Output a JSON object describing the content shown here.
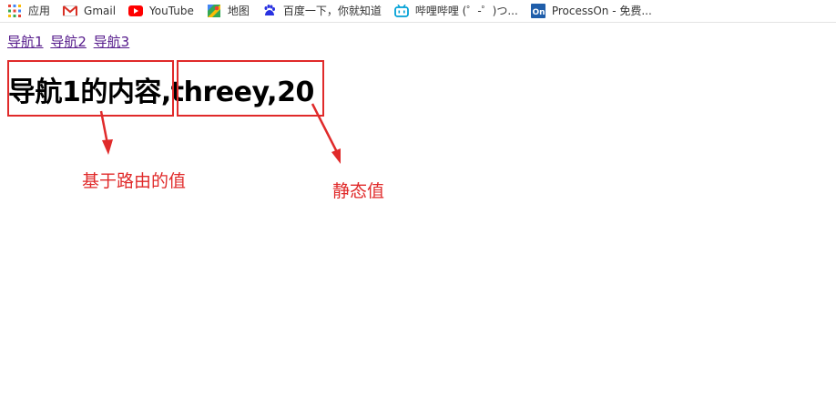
{
  "bookmarks": [
    {
      "label": "应用",
      "icon": "apps-grid-icon"
    },
    {
      "label": "Gmail",
      "icon": "gmail-icon"
    },
    {
      "label": "YouTube",
      "icon": "youtube-icon"
    },
    {
      "label": "地图",
      "icon": "maps-icon"
    },
    {
      "label": "百度一下，你就知道",
      "icon": "baidu-icon"
    },
    {
      "label": "哔哩哔哩 (゜-゜)つ...",
      "icon": "bilibili-icon"
    },
    {
      "label": "ProcessOn - 免费...",
      "icon": "processon-icon"
    }
  ],
  "nav": {
    "links": [
      "导航1",
      "导航2",
      "导航3"
    ]
  },
  "main": {
    "route_value": "导航1的内容",
    "static_value": ",threey,20"
  },
  "annotations": {
    "route_note": "基于路由的值",
    "static_note": "静态值"
  },
  "colors": {
    "annotation": "#e02a2a",
    "visited_link": "#551a8b"
  }
}
